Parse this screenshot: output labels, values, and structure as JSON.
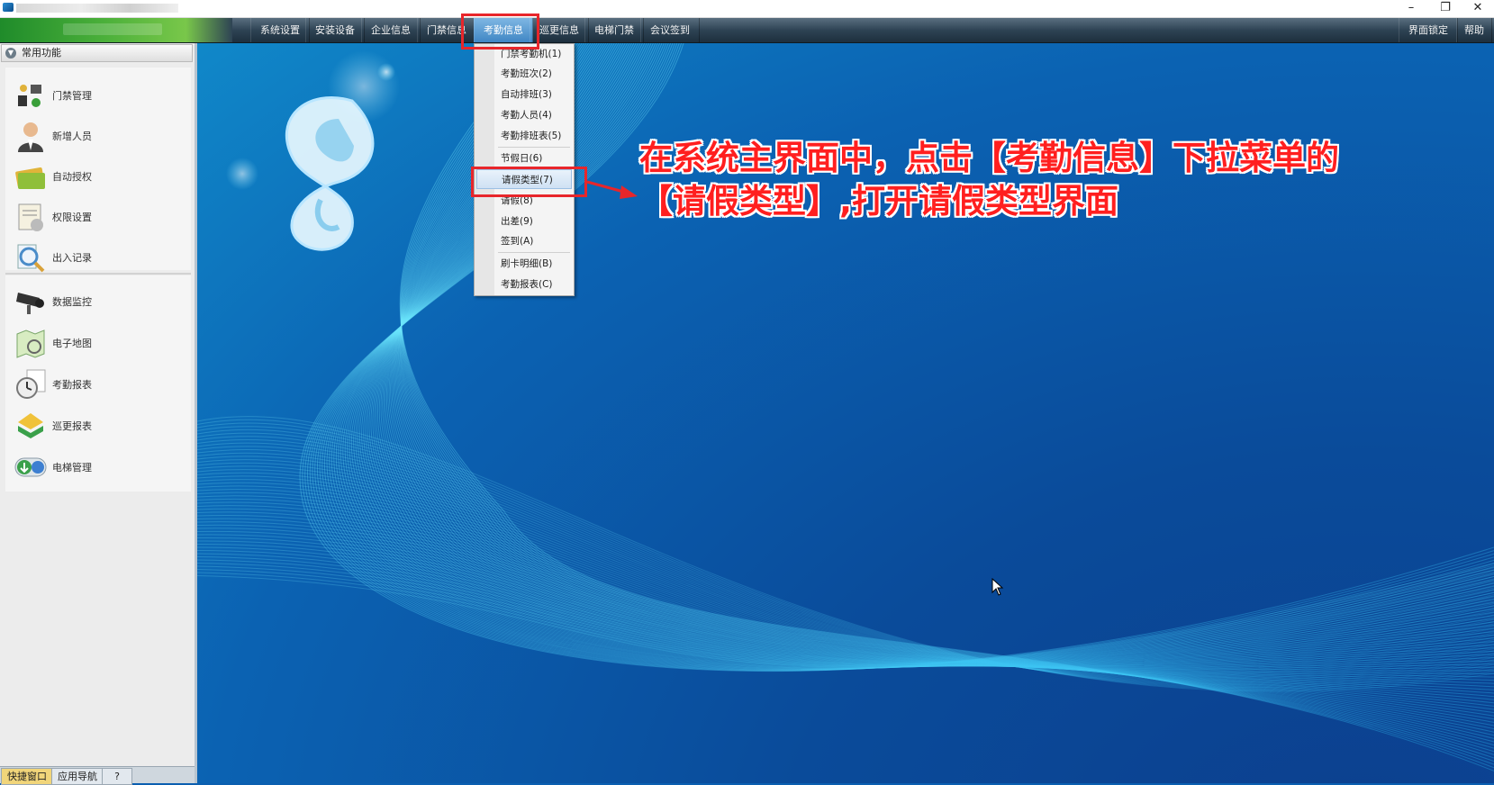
{
  "window": {
    "minimize_glyph": "–",
    "restore_glyph": "❐",
    "close_glyph": "✕"
  },
  "menubar": {
    "items": [
      "系统设置",
      "安装设备",
      "企业信息",
      "门禁信息",
      "考勤信息",
      "巡更信息",
      "电梯门禁",
      "会议签到"
    ],
    "active_item": "考勤信息",
    "right_items": [
      "界面锁定",
      "帮助"
    ]
  },
  "sidebar": {
    "header": "常用功能",
    "group1": [
      {
        "label": "门禁管理",
        "icon": "door-access-icon"
      },
      {
        "label": "新增人员",
        "icon": "person-icon"
      },
      {
        "label": "自动授权",
        "icon": "card-icon"
      },
      {
        "label": "权限设置",
        "icon": "permission-icon"
      },
      {
        "label": "出入记录",
        "icon": "search-record-icon"
      }
    ],
    "group2": [
      {
        "label": "数据监控",
        "icon": "camera-icon"
      },
      {
        "label": "电子地图",
        "icon": "map-icon"
      },
      {
        "label": "考勤报表",
        "icon": "clock-icon"
      },
      {
        "label": "巡更报表",
        "icon": "patrol-icon"
      },
      {
        "label": "电梯管理",
        "icon": "elevator-icon"
      }
    ],
    "bottom_tabs": [
      "快捷窗口",
      "应用导航",
      "?"
    ]
  },
  "dropdown": {
    "items": [
      "门禁考勤机(1)",
      "考勤班次(2)",
      "自动排班(3)",
      "考勤人员(4)",
      "考勤排班表(5)",
      "节假日(6)",
      "请假类型(7)",
      "请假(8)",
      "出差(9)",
      "签到(A)",
      "刷卡明细(B)",
      "考勤报表(C)"
    ],
    "highlighted": "请假类型(7)"
  },
  "annotation": {
    "line1": "在系统主界面中，点击【考勤信息】下拉菜单的",
    "line2": "【请假类型】,打开请假类型界面",
    "color": "#ff1f1f"
  },
  "colors": {
    "highlight_box": "#e8262b",
    "desktop_blue": "#0b5fb0",
    "menubar": "#2e4354"
  }
}
